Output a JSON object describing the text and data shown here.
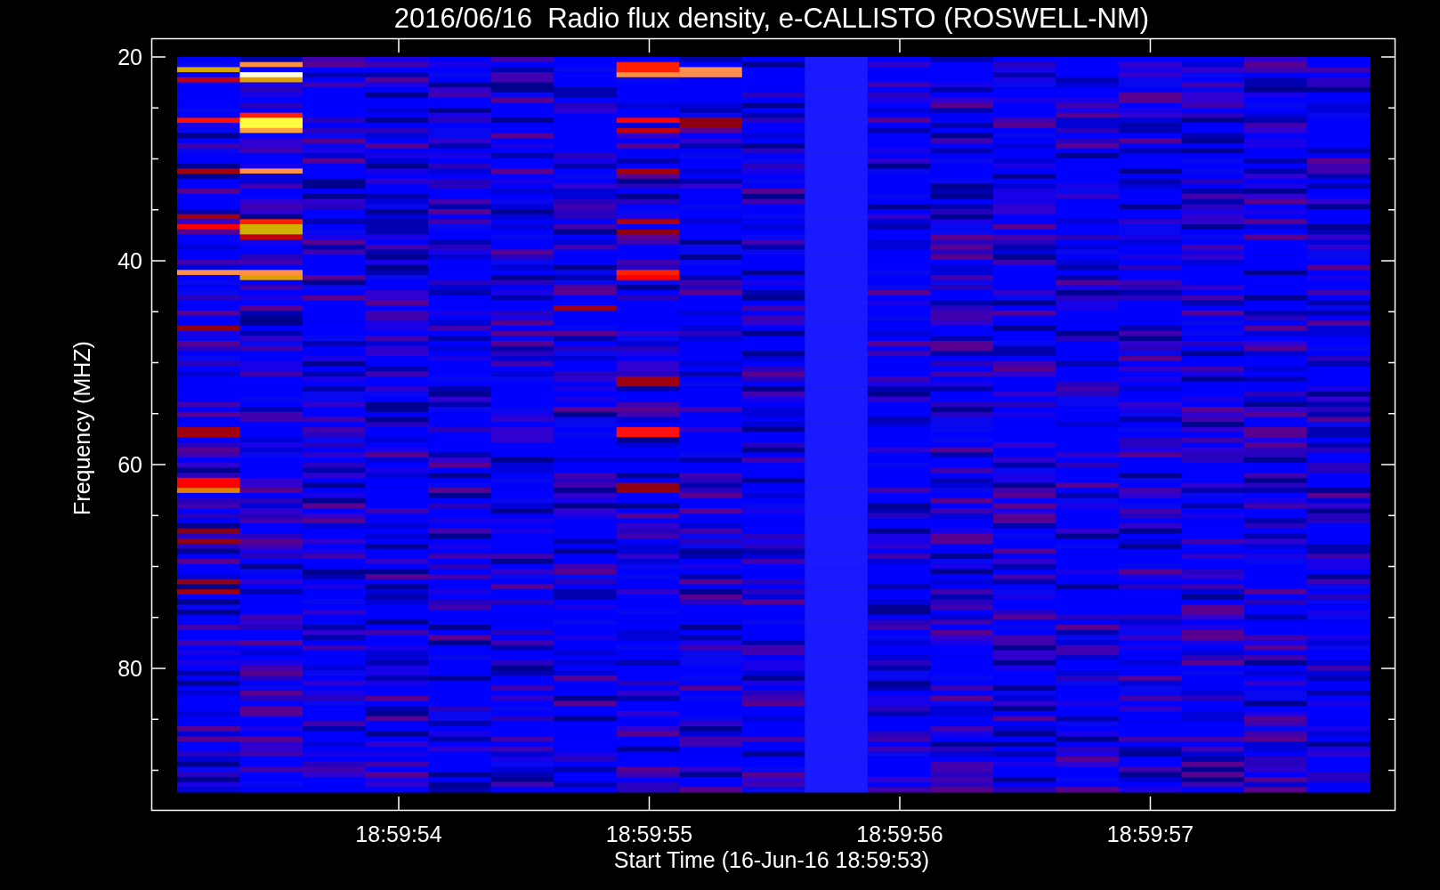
{
  "title": "2016/06/16  Radio flux density, e-CALLISTO (ROSWELL-NM)",
  "y_axis": {
    "label": "Frequency (MHZ)",
    "ticks": [
      "20",
      "40",
      "60",
      "80"
    ]
  },
  "x_axis": {
    "label": "Start Time (16-Jun-16 18:59:53)",
    "ticks": [
      "18:59:54",
      "18:59:55",
      "18:59:56",
      "18:59:57"
    ]
  }
}
